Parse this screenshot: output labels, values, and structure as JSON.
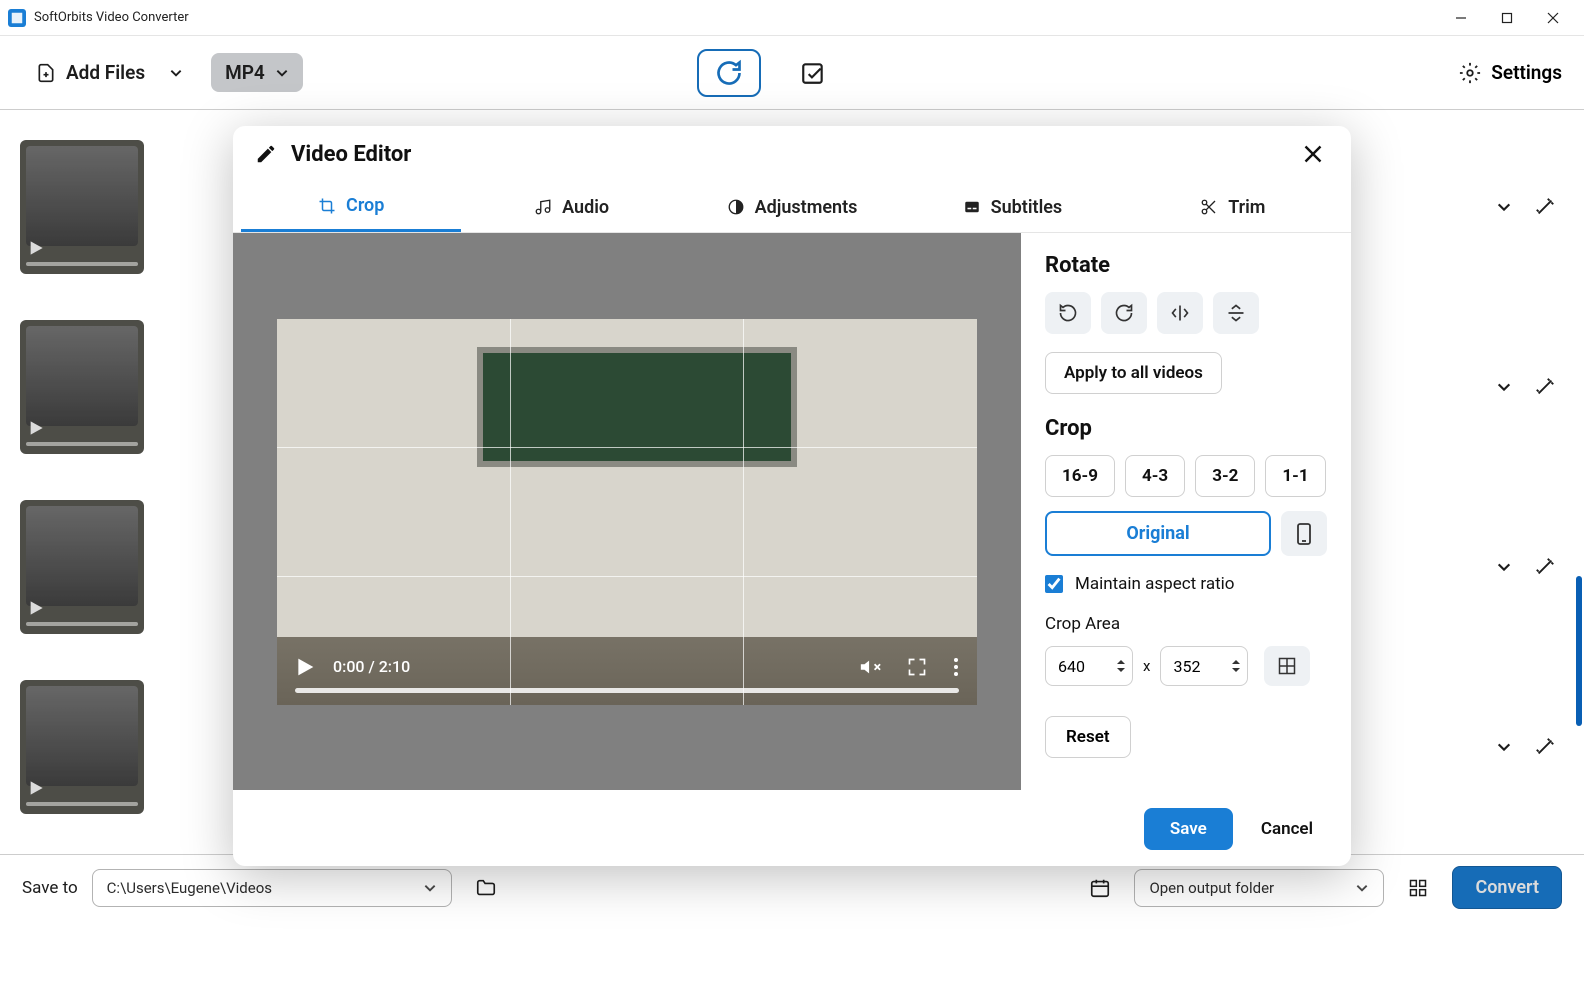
{
  "app": {
    "title": "SoftOrbits Video Converter"
  },
  "toolbar": {
    "add_files": "Add Files",
    "format": "MP4",
    "settings": "Settings"
  },
  "bottom": {
    "save_to": "Save to",
    "path": "C:\\Users\\Eugene\\Videos",
    "open_output": "Open output folder",
    "convert": "Convert"
  },
  "modal": {
    "title": "Video Editor",
    "tabs": {
      "crop": "Crop",
      "audio": "Audio",
      "adjustments": "Adjustments",
      "subtitles": "Subtitles",
      "trim": "Trim"
    },
    "video": {
      "time": "0:00 / 2:10"
    },
    "rotate": {
      "heading": "Rotate",
      "apply_all": "Apply to all videos"
    },
    "crop": {
      "heading": "Crop",
      "r169": "16-9",
      "r43": "4-3",
      "r32": "3-2",
      "r11": "1-1",
      "original": "Original",
      "maintain": "Maintain aspect ratio",
      "area_label": "Crop Area",
      "w": "640",
      "h": "352",
      "sep": "x",
      "reset": "Reset"
    },
    "footer": {
      "save": "Save",
      "cancel": "Cancel"
    }
  }
}
